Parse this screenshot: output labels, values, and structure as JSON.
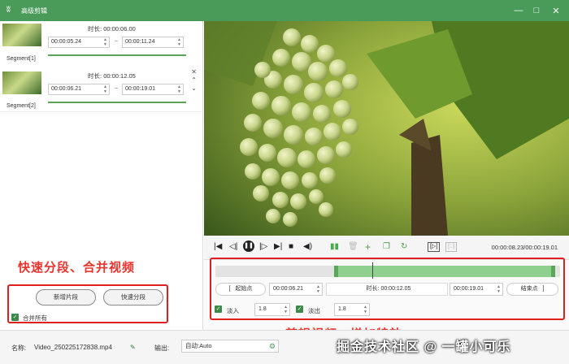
{
  "window": {
    "title": "高级剪辑"
  },
  "segments": [
    {
      "label": "Segment[1]",
      "duration_label": "时长:",
      "duration": "00:00:06.00",
      "start": "00:00:05.24",
      "end": "00:00:11.24"
    },
    {
      "label": "Segment[2]",
      "duration_label": "时长:",
      "duration": "00:00:12.05",
      "start": "00:00:06.21",
      "end": "00:00:19.01"
    }
  ],
  "left_panel": {
    "add_segment": "新增片段",
    "quick_segment": "快速分段",
    "merge_all": "合并所有",
    "merge_all_checked": true
  },
  "annotations": {
    "left": "快速分段、合并视频",
    "right": "剪辑视频、增加特效"
  },
  "player": {
    "timecode": "00:00:08.23/00:00:19.01"
  },
  "edit": {
    "start_btn": "起始点",
    "start_time": "00:00:06.21",
    "duration_label": "时长:",
    "duration": "00:00:12.05",
    "end_time": "00:00:19.01",
    "end_btn": "结束点",
    "fade_in_label": "淡入",
    "fade_in": "1.8",
    "fade_in_checked": true,
    "fade_out_label": "淡出",
    "fade_out": "1.8",
    "fade_out_checked": true,
    "selection_start": 0.36,
    "selection_end": 1.0,
    "playhead": 0.458
  },
  "bottom": {
    "name_label": "名称:",
    "file_name": "Video_250225172838.mp4",
    "output_label": "输出:",
    "output_value": "自动:Auto"
  },
  "watermark": "掘金技术社区 @ 一罐小可乐",
  "colors": {
    "title_bar": "#4a9a5a",
    "accent": "#57a857",
    "annotation": "#e8342e"
  }
}
